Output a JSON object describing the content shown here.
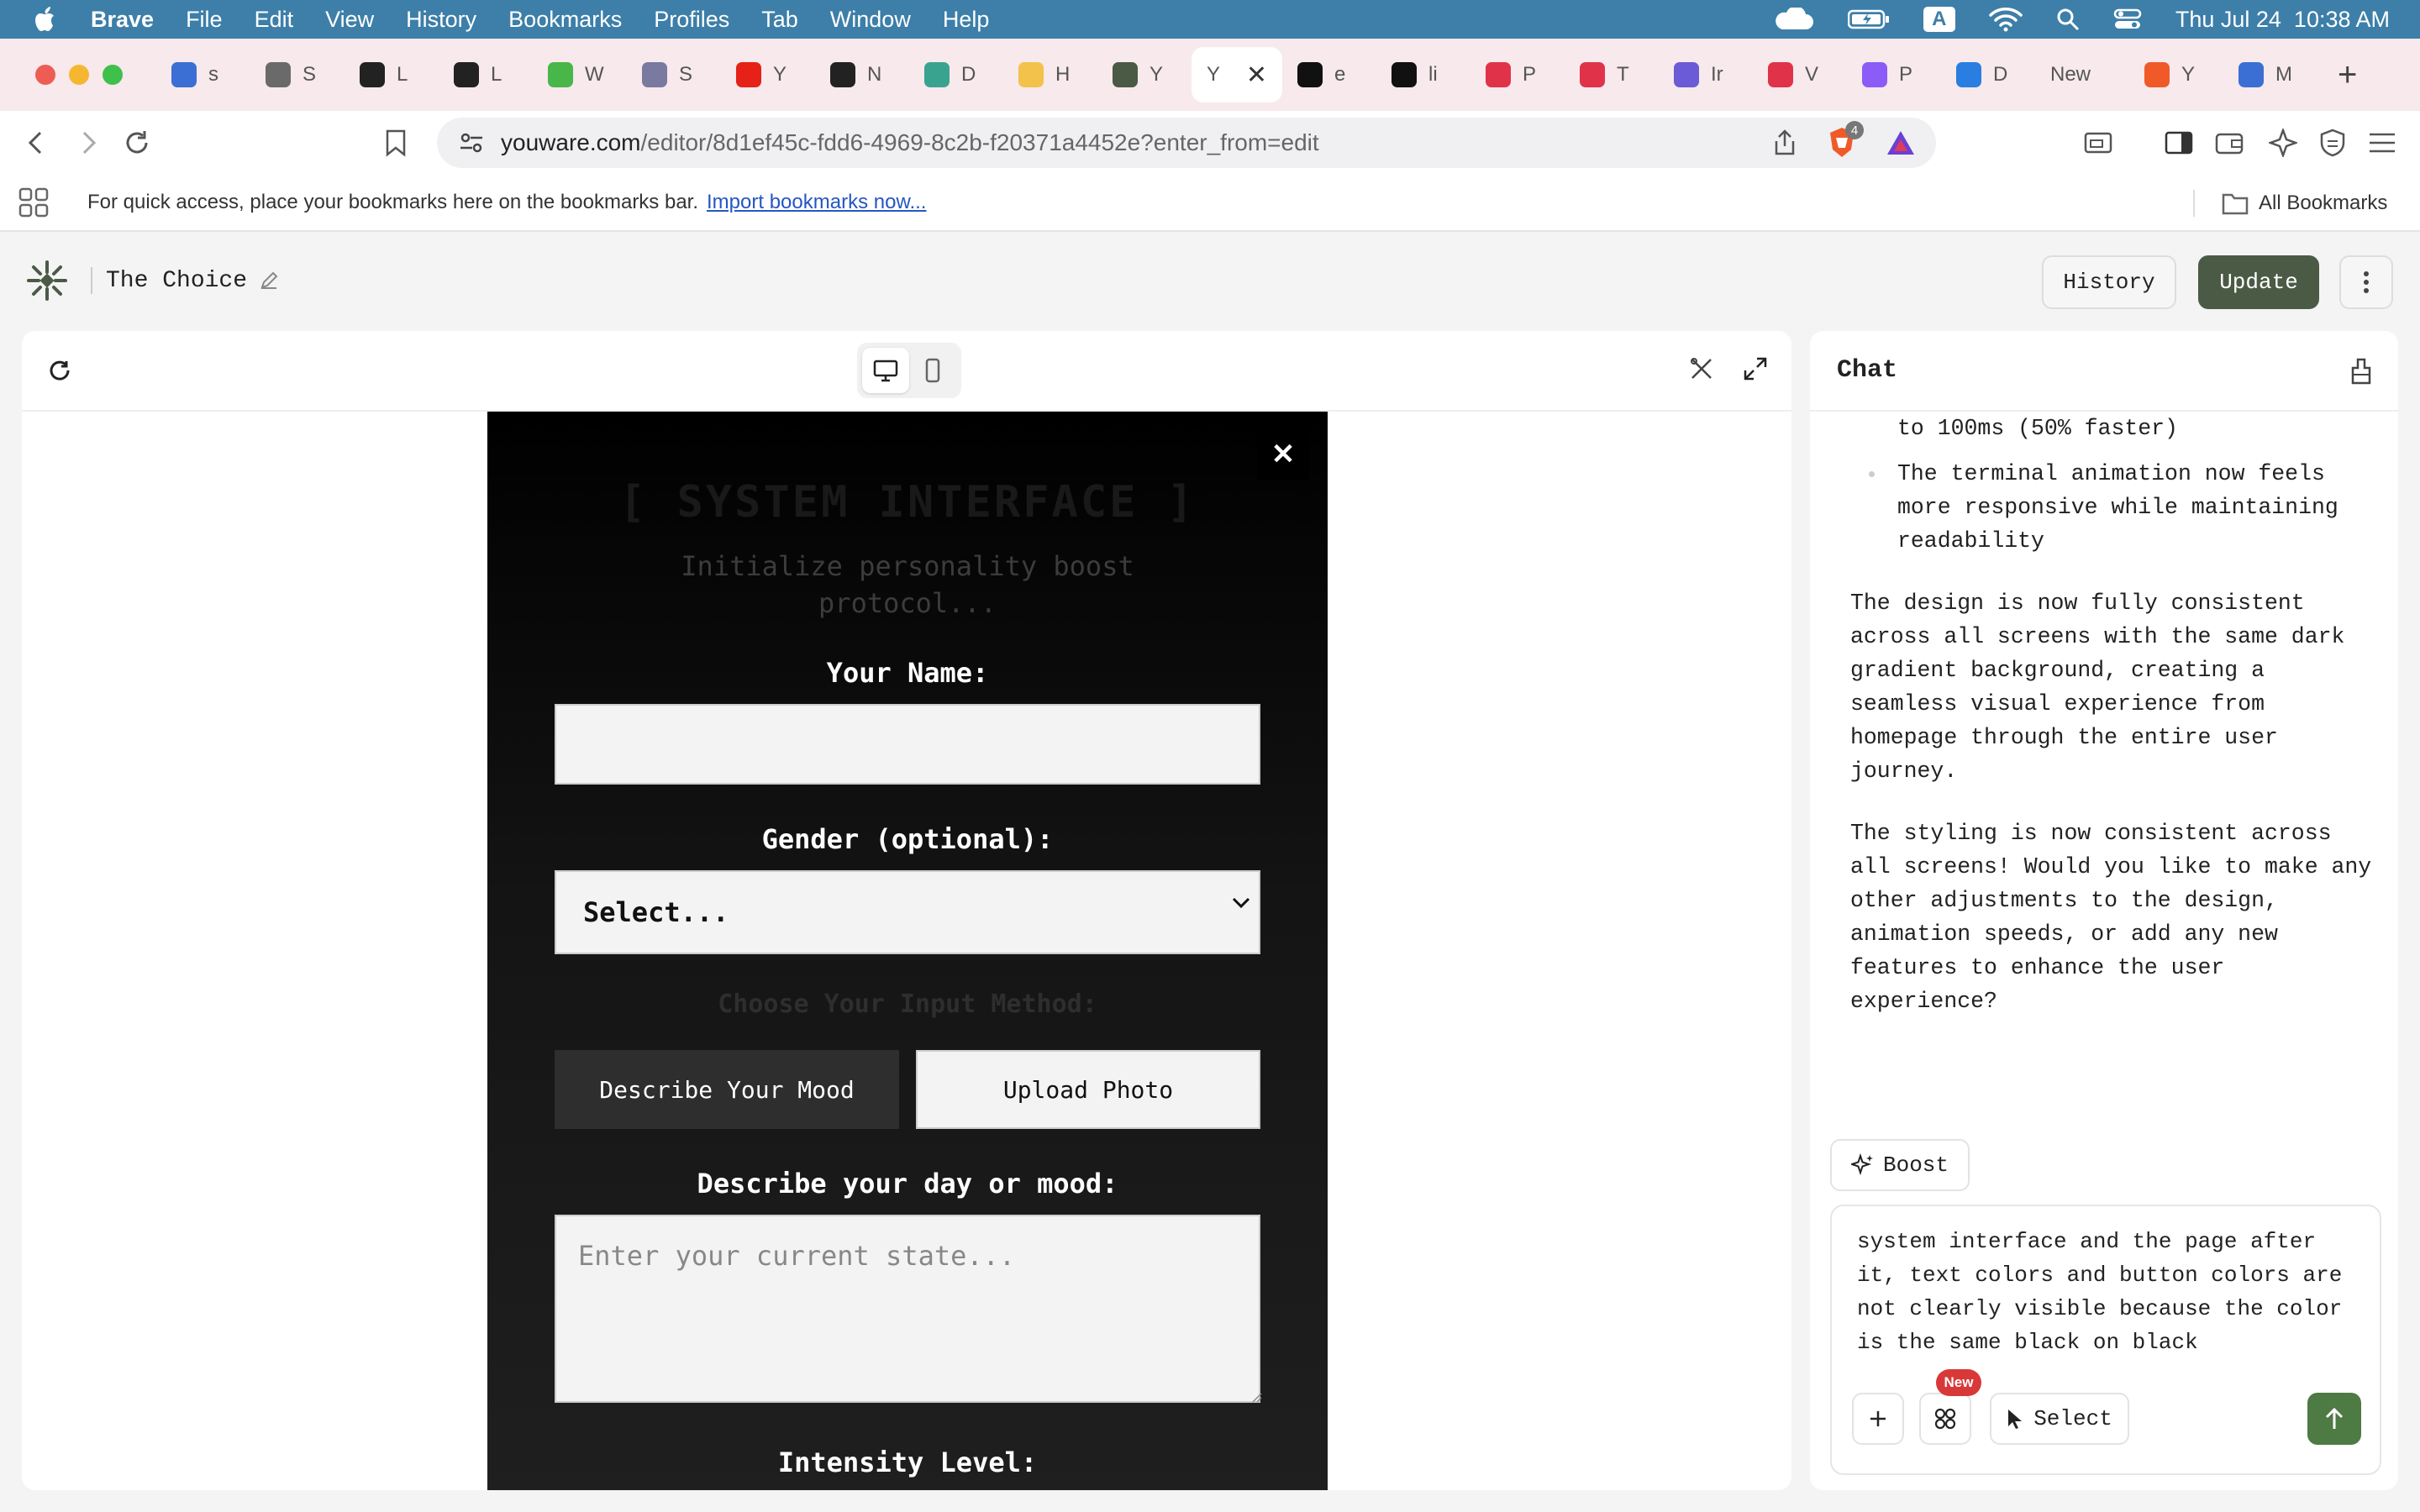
{
  "menubar": {
    "app": "Brave",
    "items": [
      "File",
      "Edit",
      "View",
      "History",
      "Bookmarks",
      "Profiles",
      "Tab",
      "Window",
      "Help"
    ],
    "input_indicator": "A",
    "datetime": "Thu Jul 24  10:38 AM"
  },
  "tabs": [
    {
      "label": "s",
      "color": "#3b6fd4"
    },
    {
      "label": "S",
      "color": "#6a6a6a"
    },
    {
      "label": "L",
      "color": "#222222"
    },
    {
      "label": "L",
      "color": "#222222"
    },
    {
      "label": "W",
      "color": "#49b64a"
    },
    {
      "label": "S",
      "color": "#7a7aa0"
    },
    {
      "label": "Y",
      "color": "#e62117"
    },
    {
      "label": "N",
      "color": "#222222"
    },
    {
      "label": "D",
      "color": "#3aa38f"
    },
    {
      "label": "H",
      "color": "#f2c24b"
    },
    {
      "label": "Y",
      "color": "#4b5a45"
    },
    {
      "label": "Y",
      "color": "#ffffff",
      "active": true
    },
    {
      "label": "e",
      "color": "#111111"
    },
    {
      "label": "li",
      "color": "#111111"
    },
    {
      "label": "P",
      "color": "#e0334a"
    },
    {
      "label": "T",
      "color": "#e0334a"
    },
    {
      "label": "Ir",
      "color": "#6b5bd6"
    },
    {
      "label": "V",
      "color": "#e0334a"
    },
    {
      "label": "P",
      "color": "#8b5cf6"
    },
    {
      "label": "D",
      "color": "#2a7de1"
    },
    {
      "label": "New",
      "color": ""
    },
    {
      "label": "Y",
      "color": "#f05a28"
    },
    {
      "label": "M",
      "color": "#3b6fd4"
    }
  ],
  "address": {
    "host": "youware.com",
    "path": "/editor/8d1ef45c-fdd6-4969-8c2b-f20371a4452e?enter_from=edit",
    "shield_count": "4"
  },
  "bookmarks_bar": {
    "message": "For quick access, place your bookmarks here on the bookmarks bar.",
    "import_link": "Import bookmarks now...",
    "all_bookmarks": "All Bookmarks"
  },
  "app_header": {
    "project_title": "The Choice",
    "history_label": "History",
    "update_label": "Update"
  },
  "modal": {
    "title": "[ SYSTEM INTERFACE ]",
    "subtitle": "Initialize personality boost protocol...",
    "name_label": "Your Name:",
    "name_value": "",
    "gender_label": "Gender (optional):",
    "gender_selected": "Select...",
    "input_method_label": "Choose Your Input Method:",
    "mood_button": "Describe Your Mood",
    "photo_button": "Upload Photo",
    "describe_label": "Describe your day or mood:",
    "describe_placeholder": "Enter your current state...",
    "intensity_label": "Intensity Level:"
  },
  "chat": {
    "title": "Chat",
    "bullets": [
      "to 100ms (50% faster)",
      "The terminal animation now feels more responsive while maintaining readability"
    ],
    "paragraphs": [
      "The design is now fully consistent across all screens with the same dark gradient background, creating a seamless visual experience from homepage through the entire user journey.",
      "The styling is now consistent across all screens! Would you like to make any other adjustments to the design, animation speeds, or add any new features to enhance the user experience?"
    ],
    "boost_label": "Boost",
    "composer_text": "system interface and the page after it, text colors and button colors are not clearly visible because the color is the same black on black",
    "new_badge": "New",
    "select_label": "Select"
  }
}
